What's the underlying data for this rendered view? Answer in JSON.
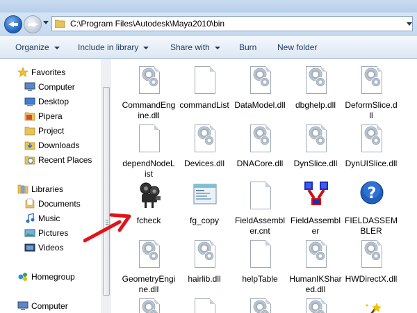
{
  "address": {
    "path": "C:\\Program Files\\Autodesk\\Maya2010\\bin"
  },
  "toolbar": {
    "organize": "Organize",
    "include": "Include in library",
    "share": "Share with",
    "burn": "Burn",
    "new_folder": "New folder"
  },
  "nav": {
    "favorites": "Favorites",
    "computer_fav": "Computer",
    "desktop": "Desktop",
    "pipera": "Pipera",
    "project": "Project",
    "downloads": "Downloads",
    "recent": "Recent Places",
    "libraries": "Libraries",
    "documents": "Documents",
    "music": "Music",
    "pictures": "Pictures",
    "videos": "Videos",
    "homegroup": "Homegroup",
    "computer": "Computer"
  },
  "files": {
    "f1": "CommandEngine.dll",
    "f2": "commandList",
    "f3": "DataModel.dll",
    "f4": "dbghelp.dll",
    "f5": "DeformSlice.dll",
    "f6": "dependNodeList",
    "f7": "Devices.dll",
    "f8": "DNACore.dll",
    "f9": "DynSlice.dll",
    "f10": "DynUISlice.dll",
    "f11": "fcheck",
    "f12": "fg_copy",
    "f13": "FieldAssembler.cnt",
    "f14": "FieldAssembler",
    "f15": "FIELDASSEMBLER",
    "f16": "GeometryEngine.dll",
    "f17": "hairlib.dll",
    "f18": "helpTable",
    "f19": "HumanIKShared.dll",
    "f20": "HWDirectX.dll"
  },
  "colors": {
    "arrow": "#e0141a",
    "accent": "#1e395b"
  }
}
